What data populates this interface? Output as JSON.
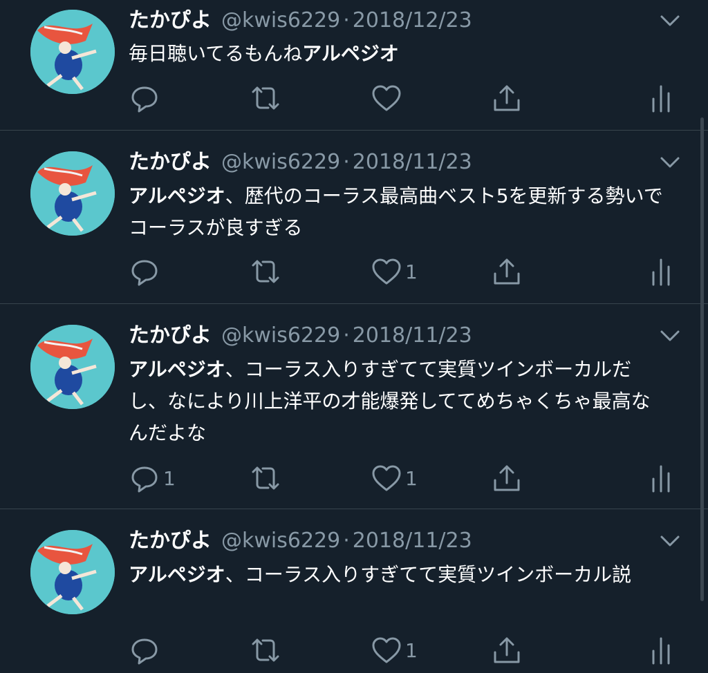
{
  "colors": {
    "background": "#15202b",
    "divider": "#38444d",
    "secondary_text": "#8899a6",
    "primary_text": "#ffffff"
  },
  "tweets": [
    {
      "name": "たかぴよ",
      "handle": "@kwis6229",
      "separator": "·",
      "date": "2018/12/23",
      "text_bold": "アルペジオ",
      "text_before": "毎日聴いてるもんね",
      "text_after": "",
      "reply_count": "",
      "retweet_count": "",
      "like_count": ""
    },
    {
      "name": "たかぴよ",
      "handle": "@kwis6229",
      "separator": "·",
      "date": "2018/11/23",
      "text_bold": "アルペジオ",
      "text_before": "",
      "text_after": "、歴代のコーラス最高曲ベスト5を更新する勢いでコーラスが良すぎる",
      "reply_count": "",
      "retweet_count": "",
      "like_count": "1"
    },
    {
      "name": "たかぴよ",
      "handle": "@kwis6229",
      "separator": "·",
      "date": "2018/11/23",
      "text_bold": "アルペジオ",
      "text_before": "",
      "text_after": "、コーラス入りすぎてて実質ツインボーカルだし、なにより川上洋平の才能爆発しててめちゃくちゃ最高なんだよな",
      "reply_count": "1",
      "retweet_count": "",
      "like_count": "1"
    },
    {
      "name": "たかぴよ",
      "handle": "@kwis6229",
      "separator": "·",
      "date": "2018/11/23",
      "text_bold": "アルペジオ",
      "text_before": "",
      "text_after": "、コーラス入りすぎてて実質ツインボーカル説",
      "reply_count": "",
      "retweet_count": "",
      "like_count": "1"
    }
  ],
  "icons": {
    "reply": "reply-icon",
    "retweet": "retweet-icon",
    "like": "heart-icon",
    "share": "share-icon",
    "analytics": "analytics-icon",
    "more": "chevron-down-icon"
  }
}
